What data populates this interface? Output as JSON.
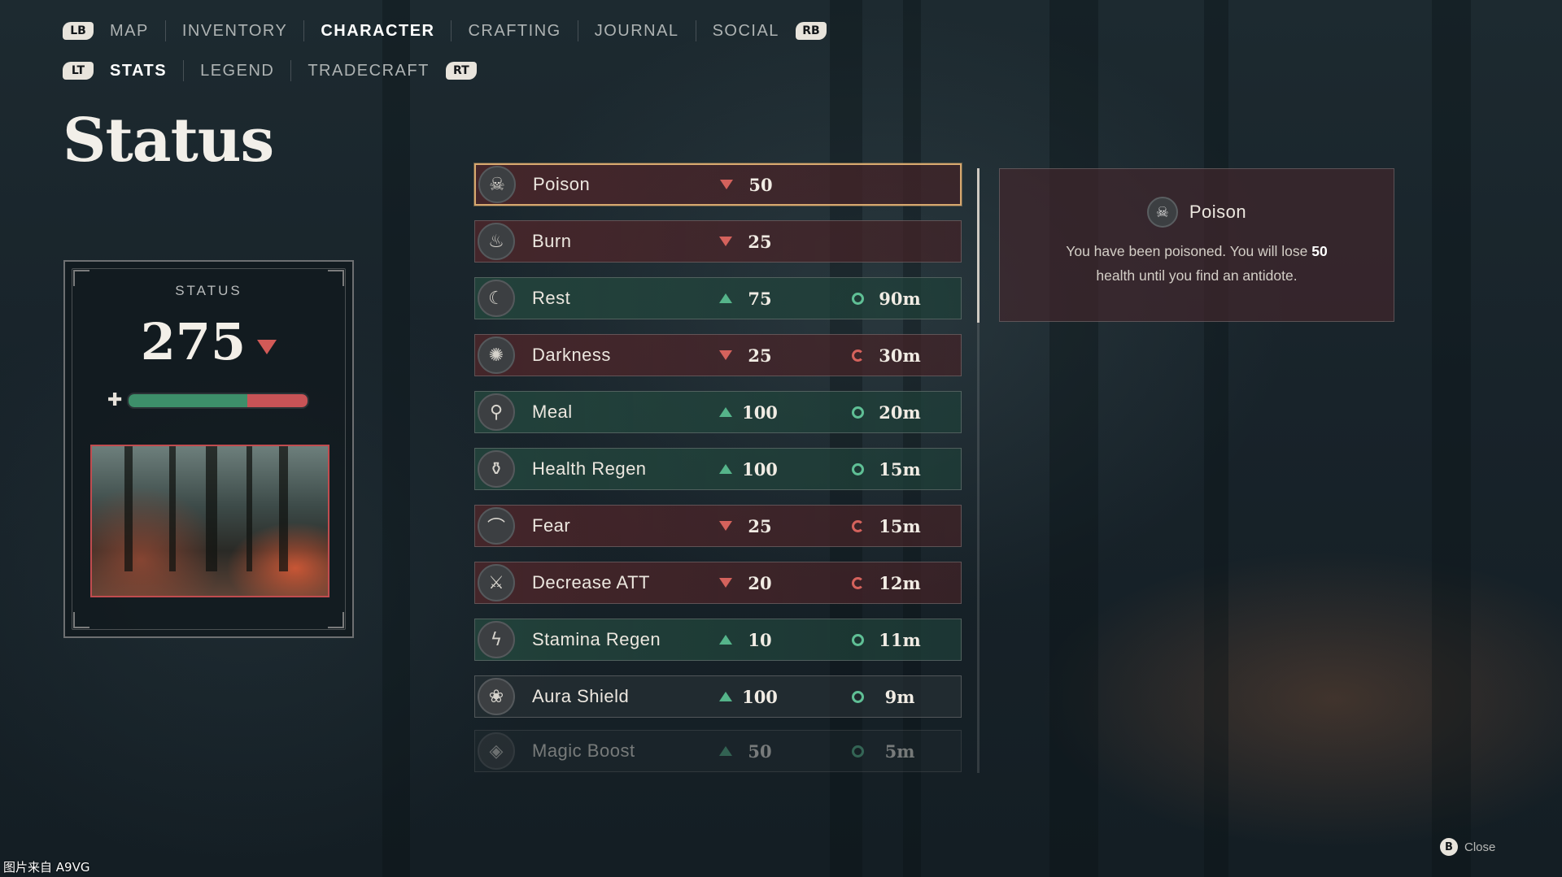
{
  "nav": {
    "primary": {
      "left_button": "LB",
      "right_button": "RB",
      "tabs": [
        "MAP",
        "INVENTORY",
        "CHARACTER",
        "CRAFTING",
        "JOURNAL",
        "SOCIAL"
      ],
      "active": "CHARACTER"
    },
    "secondary": {
      "left_button": "LT",
      "right_button": "RT",
      "tabs": [
        "STATS",
        "LEGEND",
        "TRADECRAFT"
      ],
      "active": "STATS"
    }
  },
  "page": {
    "title": "Status"
  },
  "status_card": {
    "label": "STATUS",
    "value": "275",
    "trend": "down",
    "health_bar": {
      "green_fraction": 0.66,
      "red_fraction": 0.34
    }
  },
  "status_effects": [
    {
      "icon": "skull-icon",
      "name": "Poison",
      "direction": "down",
      "value": "50",
      "time": "",
      "kind": "negative",
      "selected": true
    },
    {
      "icon": "flame-icon",
      "name": "Burn",
      "direction": "down",
      "value": "25",
      "time": "",
      "kind": "negative"
    },
    {
      "icon": "moon-icon",
      "name": "Rest",
      "direction": "up",
      "value": "75",
      "time": "90m",
      "kind": "positive"
    },
    {
      "icon": "vortex-icon",
      "name": "Darkness",
      "direction": "down",
      "value": "25",
      "time": "30m",
      "kind": "negative"
    },
    {
      "icon": "drumstick-icon",
      "name": "Meal",
      "direction": "up",
      "value": "100",
      "time": "20m",
      "kind": "positive"
    },
    {
      "icon": "potion-icon",
      "name": "Health Regen",
      "direction": "up",
      "value": "100",
      "time": "15m",
      "kind": "positive"
    },
    {
      "icon": "bat-icon",
      "name": "Fear",
      "direction": "down",
      "value": "25",
      "time": "15m",
      "kind": "negative"
    },
    {
      "icon": "broken-sword-icon",
      "name": "Decrease ATT",
      "direction": "down",
      "value": "20",
      "time": "12m",
      "kind": "negative"
    },
    {
      "icon": "lightning-icon",
      "name": "Stamina Regen",
      "direction": "up",
      "value": "10",
      "time": "11m",
      "kind": "positive"
    },
    {
      "icon": "lotus-icon",
      "name": "Aura Shield",
      "direction": "up",
      "value": "100",
      "time": "9m",
      "kind": "neutral"
    },
    {
      "icon": "gem-icon",
      "name": "Magic Boost",
      "direction": "up",
      "value": "50",
      "time": "5m",
      "kind": "neutral",
      "faded": true
    }
  ],
  "detail": {
    "icon": "skull-icon",
    "title": "Poison",
    "desc_part1": "You have been poisoned. You will lose ",
    "desc_amount": "50",
    "desc_part2": " health until you find an antidote."
  },
  "footer": {
    "close_button": "B",
    "close_label": "Close"
  },
  "watermark": "图片来自 A9VG",
  "colors": {
    "negative_row": "#4f262a",
    "positive_row": "#24483e",
    "selected_border": "#d7a86e",
    "down_arrow": "#d4625c",
    "up_arrow": "#55b48a"
  }
}
